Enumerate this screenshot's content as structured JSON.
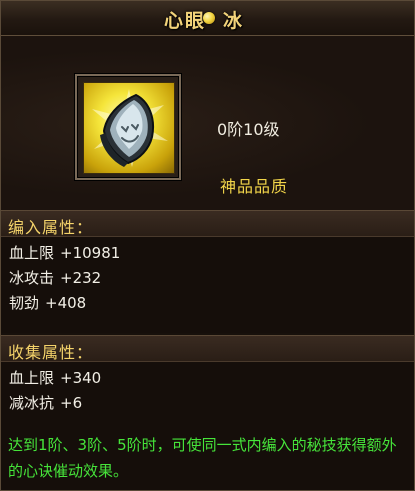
{
  "title": {
    "left": "心眼",
    "right": "冰"
  },
  "item": {
    "level": "0阶10级",
    "quality": "神品品质",
    "icon": "yellow-gem-stone-icon"
  },
  "sections": {
    "compile": {
      "label": "编入属性：",
      "stats": [
        {
          "name": "血上限",
          "value": "+10981"
        },
        {
          "name": "冰攻击",
          "value": "+232"
        },
        {
          "name": "韧劲",
          "value": "+408"
        }
      ]
    },
    "collect": {
      "label": "收集属性：",
      "stats": [
        {
          "name": "血上限",
          "value": "+340"
        },
        {
          "name": "减冰抗",
          "value": "+6"
        }
      ]
    }
  },
  "description": "达到1阶、3阶、5阶时，可使同一式内编入的秘技获得额外的心诀催动效果。",
  "colors": {
    "title": "#f2d37a",
    "section_label": "#f4d36a",
    "quality": "#f3d64a",
    "stat_text": "#f2efe6",
    "description": "#46e43a"
  }
}
